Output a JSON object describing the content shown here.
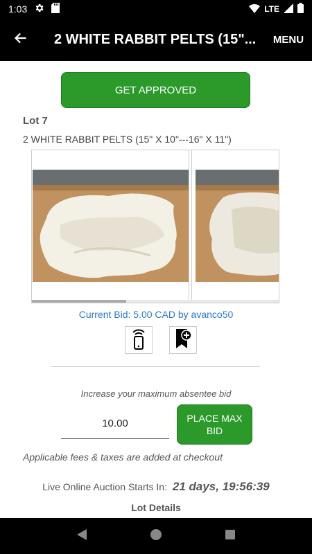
{
  "status_bar": {
    "time": "1:03",
    "network": "LTE",
    "icons": [
      "gear-icon",
      "sd-card-icon",
      "wifi-icon",
      "signal-icon",
      "battery-icon"
    ]
  },
  "app_bar": {
    "title": "2 WHITE RABBIT PELTS (15\"...",
    "menu_label": "MENU",
    "back_icon": "back-arrow-icon"
  },
  "get_approved_label": "GET APPROVED",
  "lot": {
    "number": "Lot 7",
    "title": "2 WHITE RABBIT PELTS (15\" X 10\"---16\" X 11\")"
  },
  "gallery": {
    "scroll_position_percent": 38
  },
  "current_bid": "Current Bid: 5.00 CAD by avanco50",
  "action_icons": {
    "remote": "remote-bid-icon",
    "watch": "bookmark-add-icon"
  },
  "bid": {
    "increase_label": "Increase your maximum absentee bid",
    "value": "10.00",
    "place_label": "PLACE MAX BID"
  },
  "fees_note": "Applicable fees & taxes are added at checkout",
  "auction": {
    "starts_label": "Live Online Auction Starts In:",
    "countdown": "21 days, 19:56:39"
  },
  "lot_details_label": "Lot Details",
  "colors": {
    "primary_green": "#2b9a2b",
    "link_blue": "#2a78c8",
    "bar_black": "#000000"
  }
}
